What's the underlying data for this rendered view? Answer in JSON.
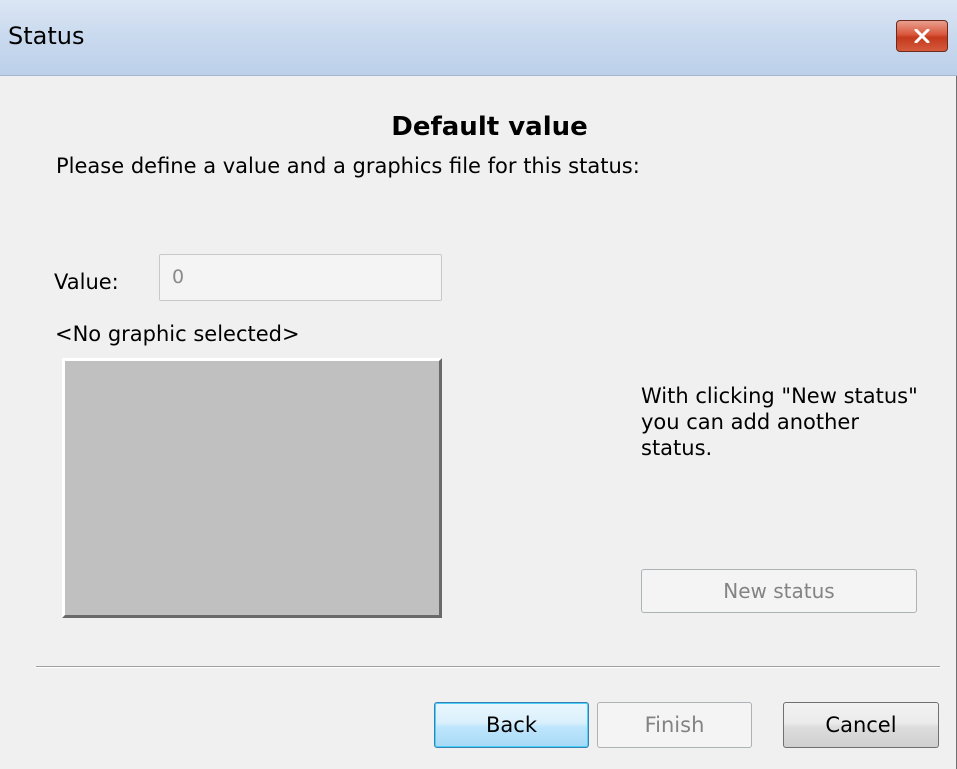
{
  "window": {
    "title": "Status"
  },
  "dialog": {
    "heading": "Default value",
    "instruction": "Please define a value and a graphics file for this status:",
    "value_label": "Value:",
    "value": "0",
    "graphic_caption": "<No graphic selected>",
    "hint": "With clicking \"New status\" you can add another status.",
    "new_status_label": "New status"
  },
  "footer": {
    "back_label": "Back",
    "finish_label": "Finish",
    "cancel_label": "Cancel"
  },
  "icons": {
    "close": "close-icon"
  },
  "colors": {
    "titlebar": "#c9d9ee",
    "close_button": "#c43a1c",
    "graphic_box": "#c0c0c0",
    "default_button_border": "#3c7fb1"
  }
}
